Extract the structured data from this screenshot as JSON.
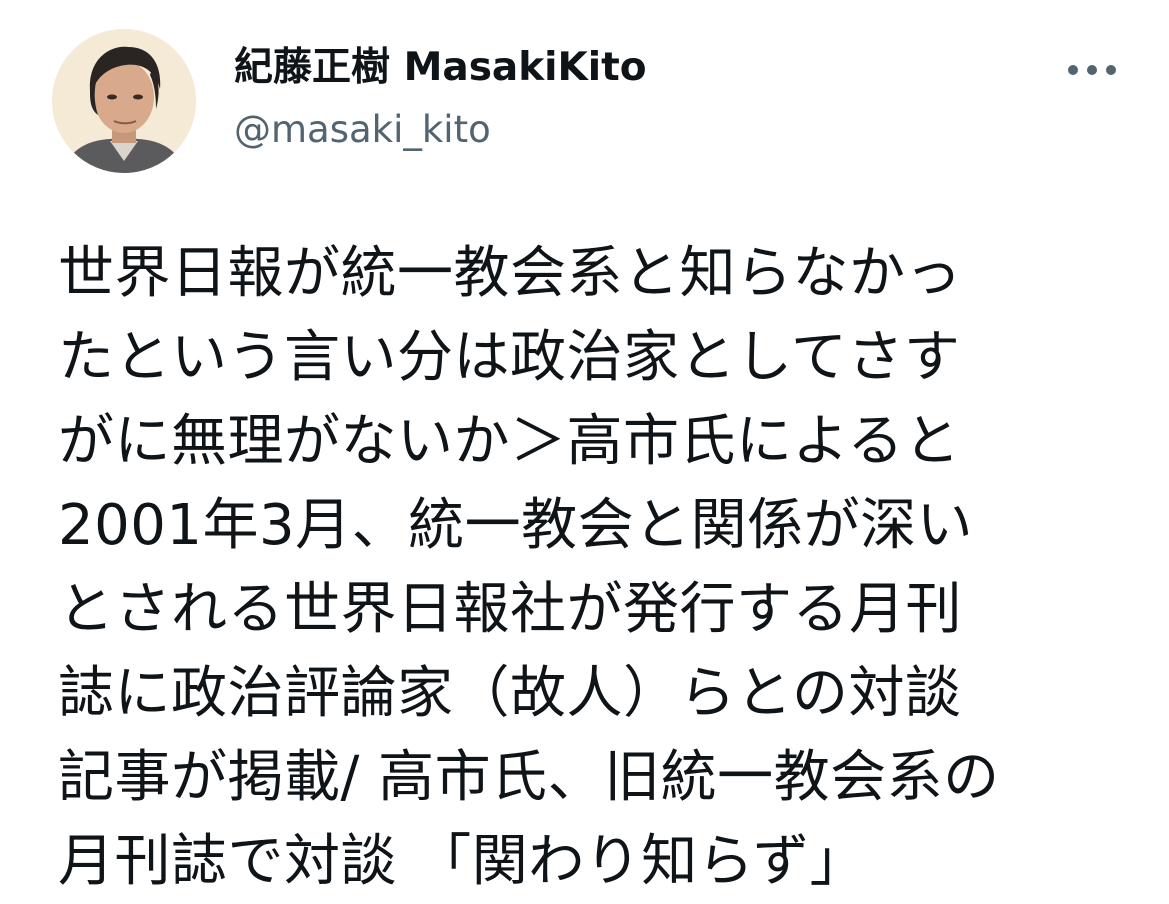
{
  "tweet": {
    "author": {
      "display_name": "紀藤正樹 MasakiKito",
      "handle": "@masaki_kito",
      "avatar_icon": "user-avatar-photo"
    },
    "more_icon": "more-dots-icon",
    "text": "世界日報が統一教会系と知らなかっ\nたという言い分は政治家としてさす\nがに無理がないか＞高市氏によると\n2001年3月、統一教会と関係が深い\nとされる世界日報社が発行する月刊\n誌に政治評論家（故人）らとの対談\n記事が掲載/ 高市氏、旧統一教会系の\n月刊誌で対談 「関わり知らず」"
  },
  "colors": {
    "text_primary": "#0f1419",
    "text_secondary": "#536471",
    "background": "#ffffff"
  }
}
